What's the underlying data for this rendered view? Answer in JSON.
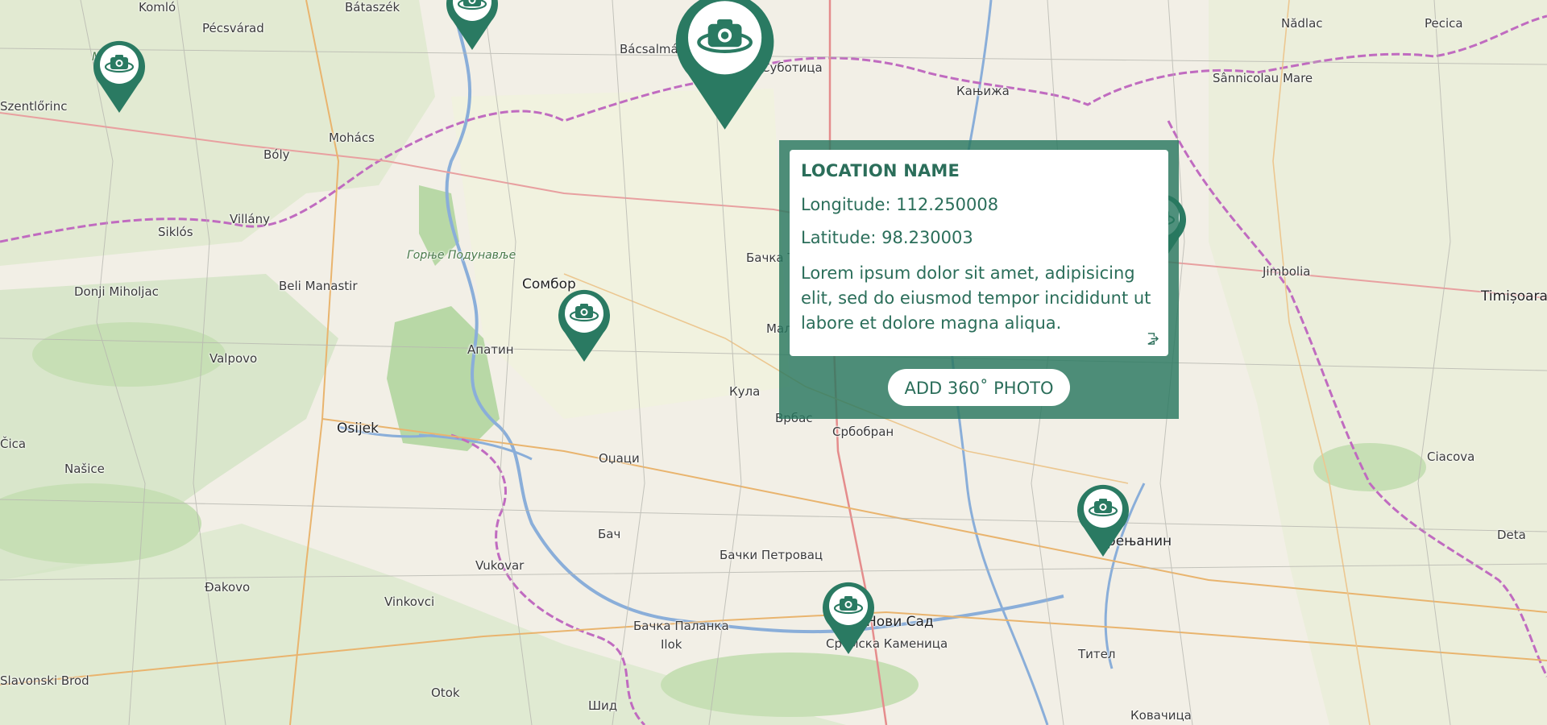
{
  "map": {
    "places": [
      {
        "name": "Komló"
      },
      {
        "name": "Bátaszék"
      },
      {
        "name": "Pécsvárad"
      },
      {
        "name": "Mecsek"
      },
      {
        "name": "Szentlőrinc"
      },
      {
        "name": "Mohács"
      },
      {
        "name": "Bóly"
      },
      {
        "name": "Villány"
      },
      {
        "name": "Siklós"
      },
      {
        "name": "Donji Miholjac"
      },
      {
        "name": "Beli Manastir"
      },
      {
        "name": "Valpovo"
      },
      {
        "name": "Osijek"
      },
      {
        "name": "Našice"
      },
      {
        "name": "Đakovo"
      },
      {
        "name": "Vinkovci"
      },
      {
        "name": "Vukovar"
      },
      {
        "name": "Slavonski Brod"
      },
      {
        "name": "Otok"
      },
      {
        "name": "Шид"
      },
      {
        "name": "Ilok"
      },
      {
        "name": "Бачка Паланка"
      },
      {
        "name": "Бач"
      },
      {
        "name": "Оџаци"
      },
      {
        "name": "Апатин"
      },
      {
        "name": "Сомбор"
      },
      {
        "name": "Горње Подунавље"
      },
      {
        "name": "Bácsalmás"
      },
      {
        "name": "Суботица"
      },
      {
        "name": "Кањижа"
      },
      {
        "name": "Бачка Топола"
      },
      {
        "name": "Мали Иђош"
      },
      {
        "name": "Кула"
      },
      {
        "name": "Врбас"
      },
      {
        "name": "Србобран"
      },
      {
        "name": "Бачки Петровац"
      },
      {
        "name": "Нови Сад"
      },
      {
        "name": "Сремска Каменица"
      },
      {
        "name": "Тител"
      },
      {
        "name": "Зрењанин"
      },
      {
        "name": "Ковачица"
      },
      {
        "name": "Nădlac"
      },
      {
        "name": "Pecica"
      },
      {
        "name": "Sânnicolau Mare"
      },
      {
        "name": "Jimbolia"
      },
      {
        "name": "Timișoara"
      },
      {
        "name": "Ciacova"
      },
      {
        "name": "Deta"
      },
      {
        "name": "Čica"
      }
    ]
  },
  "markers": [
    {
      "name": "photo-marker"
    },
    {
      "name": "photo-marker"
    },
    {
      "name": "photo-marker"
    },
    {
      "name": "photo-marker"
    },
    {
      "name": "photo-marker"
    },
    {
      "name": "photo-marker"
    },
    {
      "name": "photo-marker"
    }
  ],
  "popup": {
    "title": "LOCATION NAME",
    "longitude": "Longitude: 112.250008",
    "latitude": "Latitude: 98.230003",
    "description": "Lorem ipsum dolor sit amet, adipisicing elit, sed do eiusmod tempor incididunt ut labore et dolore magna aliqua.",
    "link_icon": "open-link-icon",
    "button_label": "ADD 360˚ PHOTO"
  },
  "colors": {
    "marker": "#2a7a62",
    "popup_overlay": "#28785f",
    "popup_text": "#2b6e5a",
    "map_bg": "#f2efe6",
    "border": "#c06bc0",
    "river": "#8aaed9",
    "forest": "#b8d8a6"
  }
}
